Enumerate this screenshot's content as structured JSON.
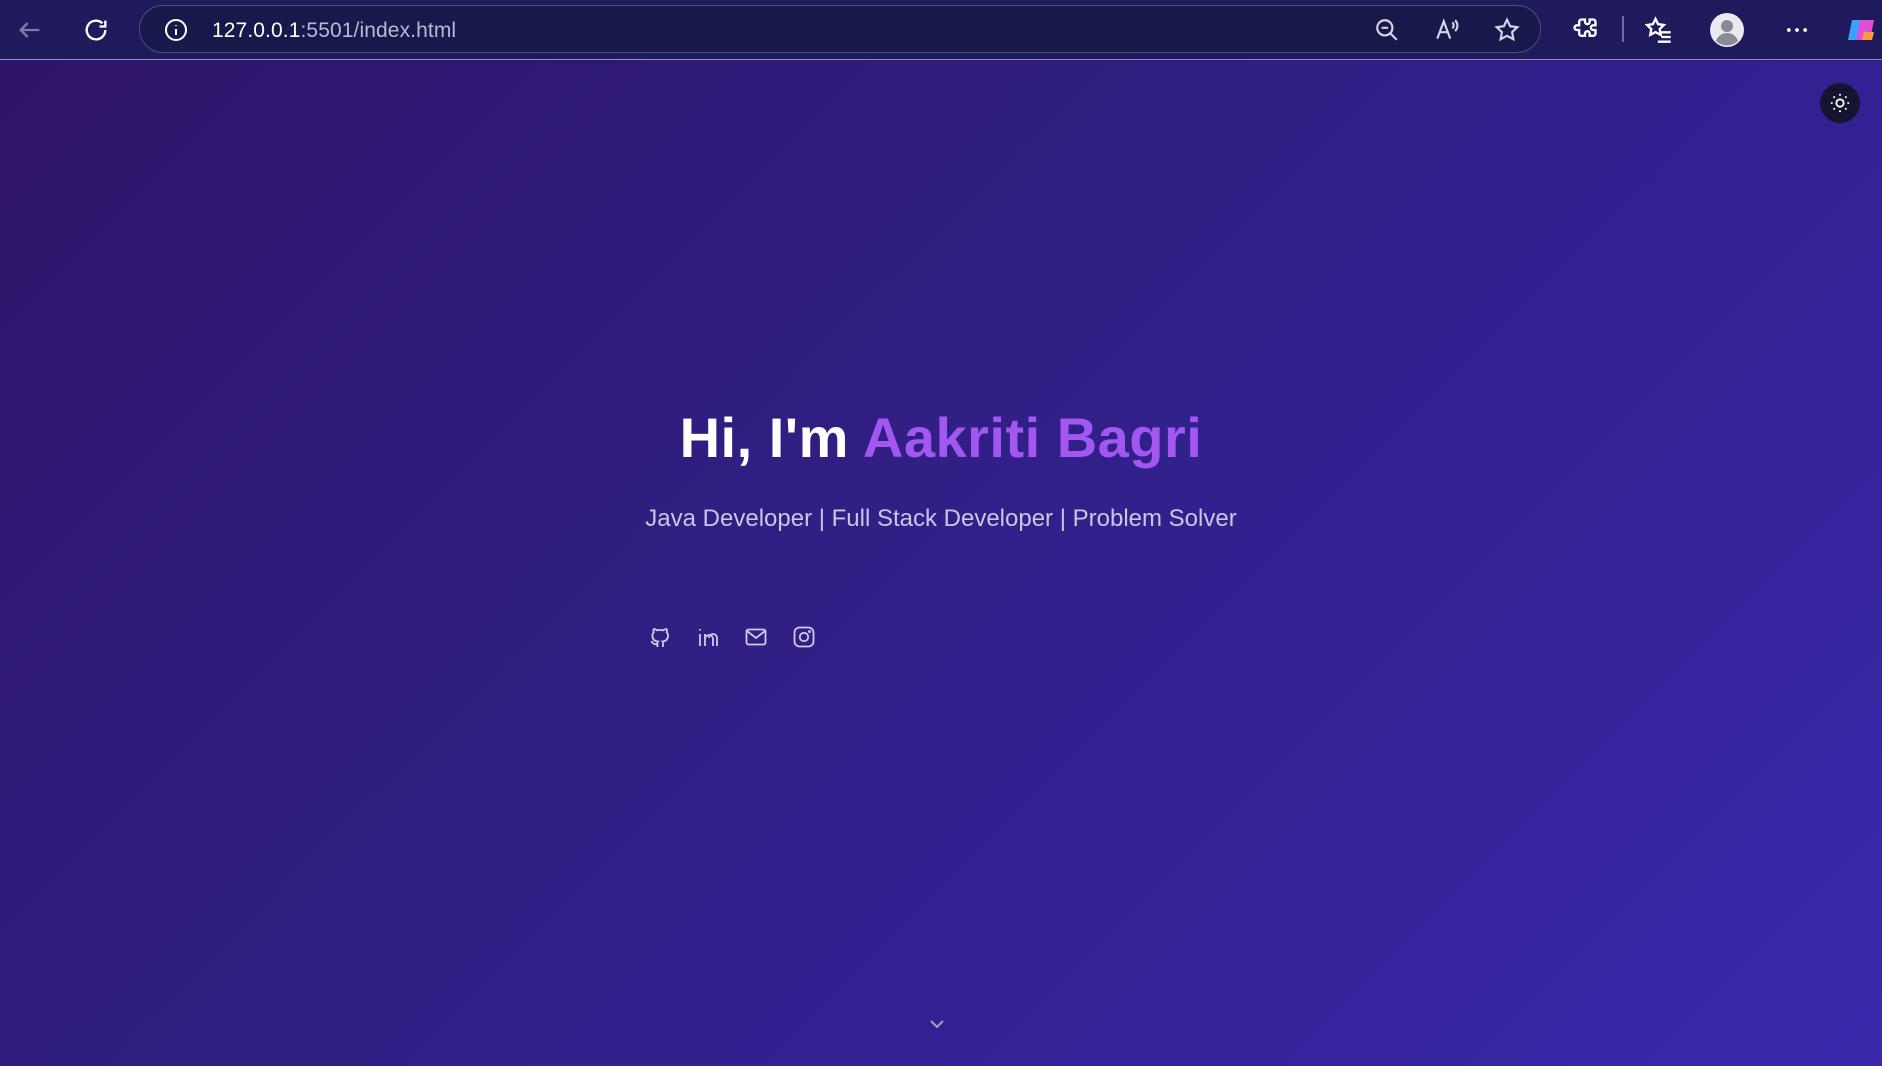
{
  "browser": {
    "url_host": "127.0.0.1",
    "url_rest": ":5501/index.html"
  },
  "icons": {
    "back": "arrow-left-icon",
    "refresh": "refresh-icon",
    "info": "info-icon",
    "zoom": "zoom-out-icon",
    "read_aloud": "read-aloud-icon",
    "favorite": "star-icon",
    "extensions": "puzzle-icon",
    "favorites": "favorites-list-icon",
    "profile": "avatar-icon",
    "more": "more-icon",
    "copilot": "copilot-icon",
    "theme": "sun-icon",
    "github": "github-icon",
    "linkedin": "linkedin-icon",
    "email": "mail-icon",
    "instagram": "instagram-icon",
    "scroll": "chevron-down-icon"
  },
  "hero": {
    "greeting": "Hi, I'm ",
    "name": "Aakriti Bagri",
    "subtitle": "Java Developer | Full Stack Developer | Problem Solver"
  },
  "colors": {
    "accent": "#a258f0",
    "background": "#311f85",
    "chrome": "#1e1a5c"
  }
}
